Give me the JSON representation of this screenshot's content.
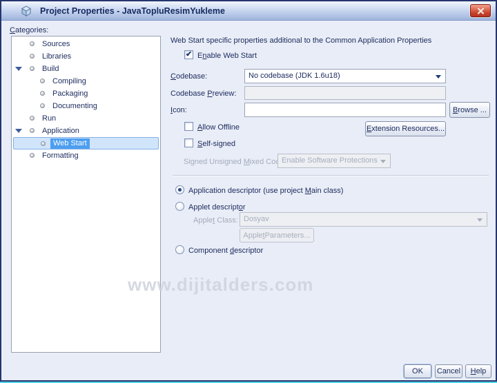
{
  "window": {
    "title": "Project Properties - JavaTopluResimYukleme"
  },
  "categories": {
    "label": "Categories:",
    "items": [
      {
        "label": "Sources",
        "level": 1,
        "expanded": false,
        "selected": false
      },
      {
        "label": "Libraries",
        "level": 1,
        "expanded": false,
        "selected": false
      },
      {
        "label": "Build",
        "level": 1,
        "expanded": true,
        "selected": false
      },
      {
        "label": "Compiling",
        "level": 2,
        "expanded": false,
        "selected": false
      },
      {
        "label": "Packaging",
        "level": 2,
        "expanded": false,
        "selected": false
      },
      {
        "label": "Documenting",
        "level": 2,
        "expanded": false,
        "selected": false
      },
      {
        "label": "Run",
        "level": 1,
        "expanded": false,
        "selected": false
      },
      {
        "label": "Application",
        "level": 1,
        "expanded": true,
        "selected": false
      },
      {
        "label": "Web Start",
        "level": 2,
        "expanded": false,
        "selected": true
      },
      {
        "label": "Formatting",
        "level": 1,
        "expanded": false,
        "selected": false
      }
    ]
  },
  "main": {
    "description": "Web Start specific properties additional to the Common Application Properties",
    "enable_web_start": {
      "label": "Enable Web Start",
      "checked": true
    },
    "codebase": {
      "label": "Codebase:",
      "value": "No codebase (JDK 1.6u18)"
    },
    "codebase_preview": {
      "label": "Codebase Preview:",
      "value": "",
      "disabled": true
    },
    "icon_row": {
      "label": "Icon:",
      "value": "",
      "browse_label": "Browse ..."
    },
    "allow_offline": {
      "label": "Allow Offline",
      "checked": false
    },
    "extension_resources_label": "Extension Resources...",
    "self_signed": {
      "label": "Self-signed",
      "checked": false
    },
    "mixed_code": {
      "label": "Signed Unsigned Mixed Code:",
      "value": "Enable Software Protections",
      "disabled": true
    },
    "descriptors": {
      "application": {
        "label": "Application descriptor (use project Main class)",
        "selected": true
      },
      "applet": {
        "label": "Applet descriptor",
        "selected": false
      },
      "applet_class": {
        "label": "Applet Class:",
        "value": "Dosyav",
        "disabled": true
      },
      "applet_parameters_label": "Applet Parameters...",
      "component": {
        "label": "Component descriptor",
        "selected": false
      }
    }
  },
  "watermark": "www.dijitalders.com",
  "footer": {
    "ok_label": "OK",
    "cancel_label": "Cancel",
    "help_label": "Help"
  },
  "colors": {
    "dialog_background": "#e9edf7",
    "window_border": "#24356e",
    "bottom_edge_cyan": "#52d5e9",
    "titlebar_top": "#f0f5fd",
    "titlebar_bottom": "#9fb4db",
    "title_text": "#152a60",
    "close_button_red": "#c23d28",
    "label_text": "#1b2a5c",
    "disabled_text": "#a6adbd",
    "selection_row": "#d0e4fb",
    "selection_label": "#4d9ef0"
  }
}
